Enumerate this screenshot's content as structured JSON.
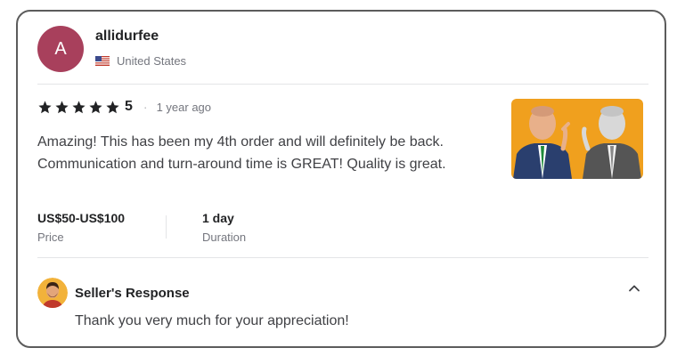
{
  "reviewer": {
    "avatar_letter": "A",
    "avatar_color": "#a8405c",
    "username": "allidurfee",
    "country": "United States",
    "flag_icon": "us-flag-icon"
  },
  "review": {
    "rating_stars": 5,
    "rating_value": "5",
    "separator": "·",
    "time_ago": "1 year ago",
    "text": "Amazing! This has been my 4th order and will definitely be back. Communication and turn-around time is GREAT! Quality is great."
  },
  "meta": {
    "price_value": "US$50-US$100",
    "price_label": "Price",
    "duration_value": "1 day",
    "duration_label": "Duration"
  },
  "seller_response": {
    "title": "Seller's Response",
    "text": "Thank you very much for your appreciation!",
    "toggle_icon": "chevron-up-icon"
  },
  "colors": {
    "star": "#222325",
    "image_background": "#f0a01e"
  }
}
